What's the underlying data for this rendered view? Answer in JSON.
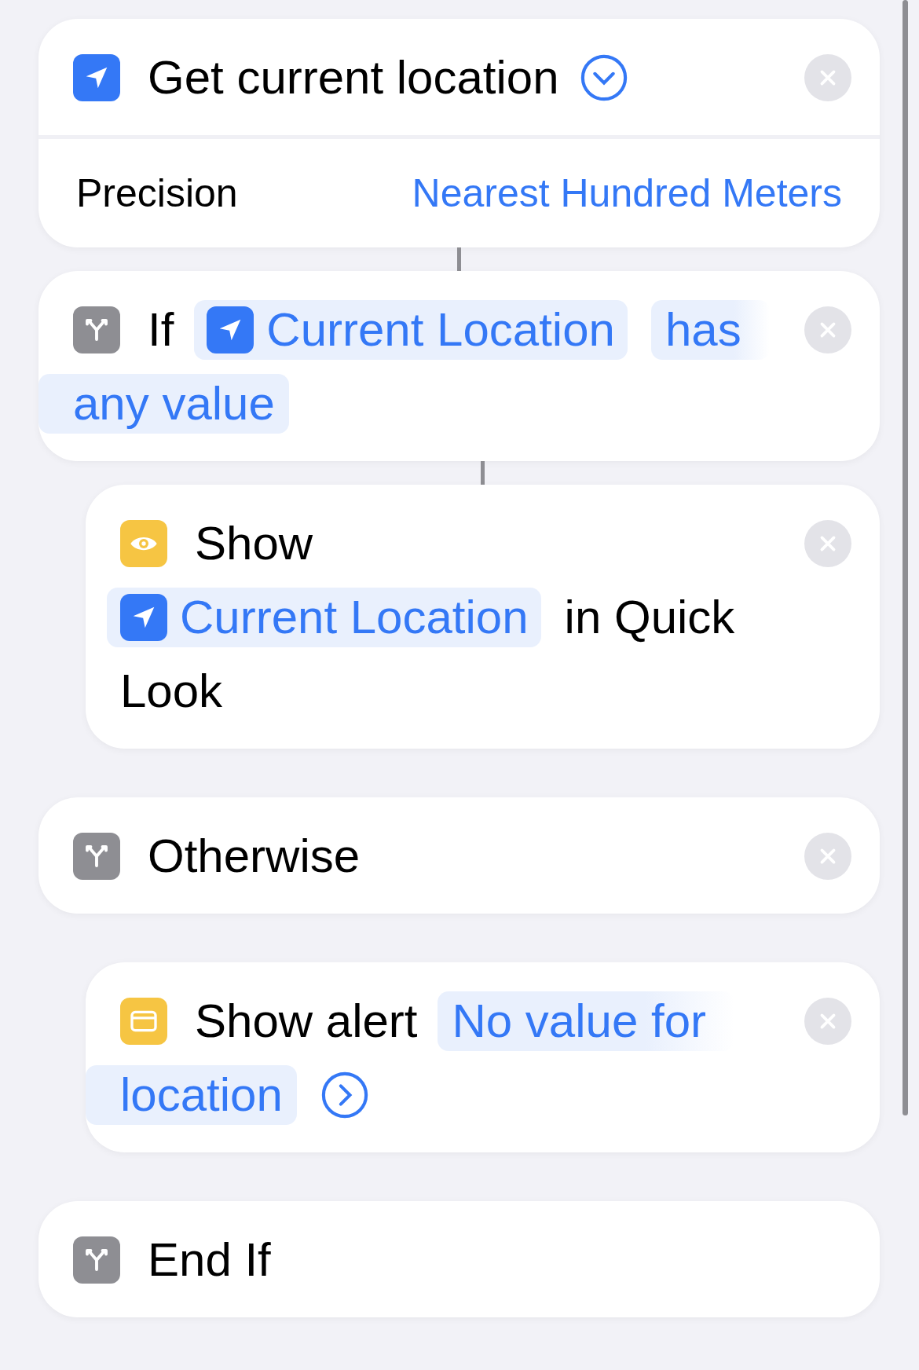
{
  "blocks": [
    {
      "kind": "get-location",
      "nested": false,
      "linked": false,
      "removable": true,
      "lines": [
        [
          {
            "kind": "text",
            "text": "Get current location"
          },
          {
            "kind": "expand"
          }
        ]
      ],
      "params": [
        {
          "label": "Precision",
          "value": "Nearest Hundred Meters"
        }
      ]
    },
    {
      "kind": "if",
      "nested": false,
      "linked": true,
      "removable": true,
      "lines": [
        [
          {
            "kind": "text",
            "text": "If"
          },
          {
            "kind": "variable",
            "text": "Current Location"
          },
          {
            "kind": "token",
            "text": "has"
          }
        ],
        [
          {
            "kind": "token",
            "text": "any value"
          }
        ]
      ]
    },
    {
      "kind": "show",
      "nested": true,
      "linked": true,
      "removable": true,
      "lines": [
        [
          {
            "kind": "text",
            "text": "Show"
          }
        ],
        [
          {
            "kind": "variable",
            "text": "Current Location"
          },
          {
            "kind": "text",
            "text": "in Quick"
          }
        ],
        [
          {
            "kind": "text",
            "text": "Look"
          }
        ]
      ]
    },
    {
      "kind": "otherwise",
      "nested": false,
      "linked": false,
      "removable": true,
      "lines": [
        [
          {
            "kind": "text",
            "text": "Otherwise"
          }
        ]
      ]
    },
    {
      "kind": "alert",
      "nested": true,
      "linked": false,
      "removable": true,
      "lines": [
        [
          {
            "kind": "text",
            "text": "Show alert"
          },
          {
            "kind": "token",
            "text": "No value for"
          }
        ],
        [
          {
            "kind": "token",
            "text": "location"
          },
          {
            "kind": "disclosure"
          }
        ]
      ]
    },
    {
      "kind": "end-if",
      "nested": false,
      "linked": false,
      "removable": false,
      "lines": [
        [
          {
            "kind": "text",
            "text": "End If"
          }
        ]
      ]
    }
  ]
}
